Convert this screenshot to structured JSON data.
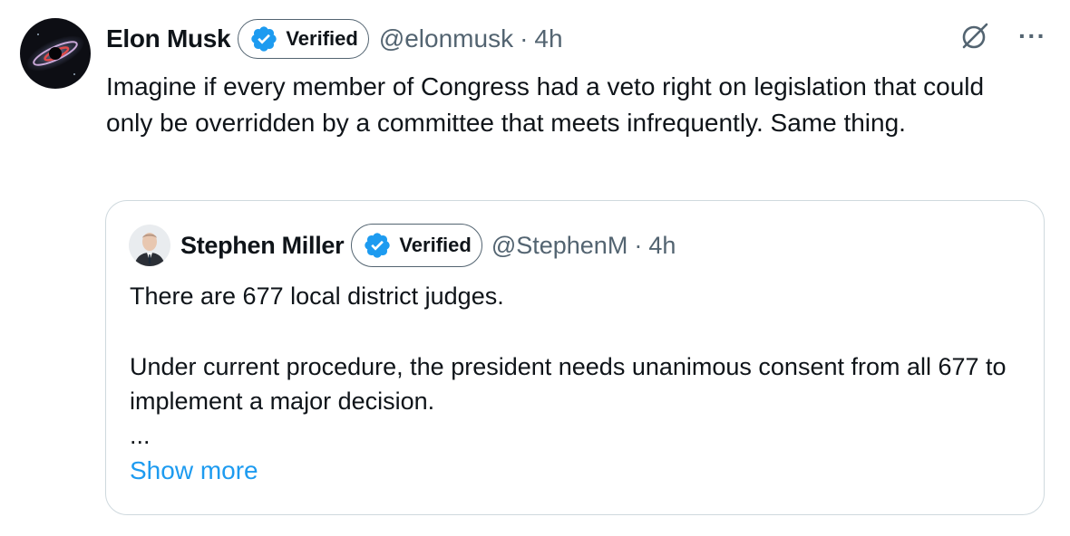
{
  "tweet": {
    "author": {
      "name": "Elon Musk",
      "verified_label": "Verified",
      "handle": "@elonmusk",
      "separator": "·",
      "time": "4h",
      "avatar_icon": "galaxy-avatar"
    },
    "actions": {
      "grok_icon": "grok-icon",
      "more_icon": "more-icon",
      "more_glyph": "···"
    },
    "text": "Imagine if every member of Congress had a veto right on legislation that could only be overridden by a committee that meets infrequently. Same thing."
  },
  "quote": {
    "author": {
      "name": "Stephen Miller",
      "verified_label": "Verified",
      "handle": "@StephenM",
      "separator": "·",
      "time": "4h"
    },
    "paragraphs": [
      "There are 677 local district judges.",
      "Under current procedure, the president needs unanimous consent from all 677 to implement a major decision.",
      "..."
    ],
    "show_more": "Show more"
  },
  "colors": {
    "text": "#0f1419",
    "secondary": "#536471",
    "verified_blue": "#1d9bf0",
    "link": "#1d9bf0",
    "border": "#cfd9de"
  }
}
